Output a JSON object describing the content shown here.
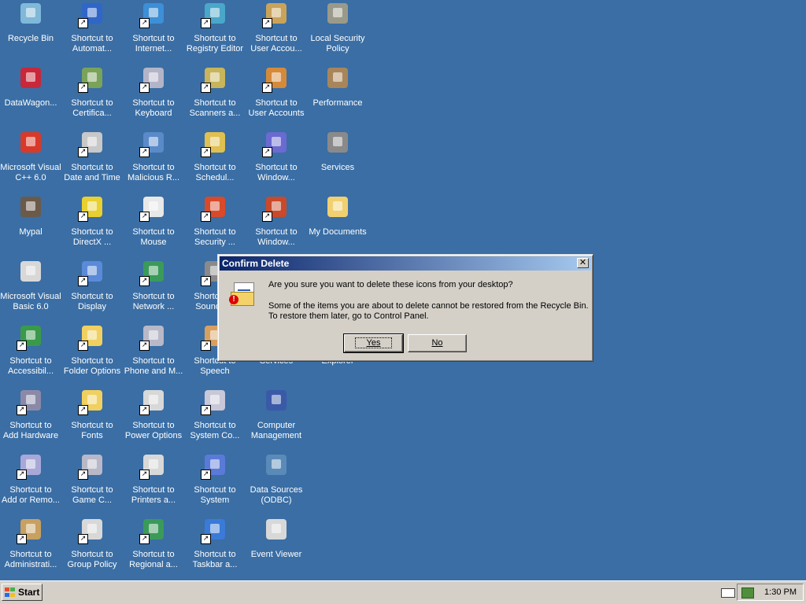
{
  "desktop": {
    "icons": [
      {
        "label": "Recycle Bin",
        "col": 0,
        "row": 0,
        "color": "#7fb8d8",
        "shortcut": false
      },
      {
        "label": "Shortcut to\nAutomat...",
        "col": 1,
        "row": 0,
        "color": "#2f66c8",
        "shortcut": true
      },
      {
        "label": "Shortcut to\nInternet...",
        "col": 2,
        "row": 0,
        "color": "#3d8fd6",
        "shortcut": true
      },
      {
        "label": "Shortcut to\nRegistry Editor",
        "col": 3,
        "row": 0,
        "color": "#4aa7c9",
        "shortcut": true
      },
      {
        "label": "Shortcut to\nUser Accou...",
        "col": 4,
        "row": 0,
        "color": "#c9a35a",
        "shortcut": true
      },
      {
        "label": "Local Security\nPolicy",
        "col": 5,
        "row": 0,
        "color": "#9a9a8a",
        "shortcut": false
      },
      {
        "label": "DataWagon...",
        "col": 0,
        "row": 1,
        "color": "#c8283a",
        "shortcut": false
      },
      {
        "label": "Shortcut to\nCertifica...",
        "col": 1,
        "row": 1,
        "color": "#7aa35a",
        "shortcut": true
      },
      {
        "label": "Shortcut to\nKeyboard",
        "col": 2,
        "row": 1,
        "color": "#b4b4c8",
        "shortcut": true
      },
      {
        "label": "Shortcut to\nScanners a...",
        "col": 3,
        "row": 1,
        "color": "#c8b45a",
        "shortcut": true
      },
      {
        "label": "Shortcut to\nUser Accounts",
        "col": 4,
        "row": 1,
        "color": "#d48a3a",
        "shortcut": true
      },
      {
        "label": "Performance",
        "col": 5,
        "row": 1,
        "color": "#a8865a",
        "shortcut": false
      },
      {
        "label": "Microsoft Visual\nC++ 6.0",
        "col": 0,
        "row": 2,
        "color": "#d83a2a",
        "shortcut": false
      },
      {
        "label": "Shortcut to\nDate and Time",
        "col": 1,
        "row": 2,
        "color": "#c8c8c8",
        "shortcut": true
      },
      {
        "label": "Shortcut to\nMalicious R...",
        "col": 2,
        "row": 2,
        "color": "#5a8ac8",
        "shortcut": true
      },
      {
        "label": "Shortcut to\nSchedul...",
        "col": 3,
        "row": 2,
        "color": "#e0c050",
        "shortcut": true
      },
      {
        "label": "Shortcut to\nWindow...",
        "col": 4,
        "row": 2,
        "color": "#6a6ad0",
        "shortcut": true
      },
      {
        "label": "Services",
        "col": 5,
        "row": 2,
        "color": "#8a8a8a",
        "shortcut": false
      },
      {
        "label": "Mypal",
        "col": 0,
        "row": 3,
        "color": "#6a5a4a",
        "shortcut": false
      },
      {
        "label": "Shortcut to\nDirectX ...",
        "col": 1,
        "row": 3,
        "color": "#e8d030",
        "shortcut": true
      },
      {
        "label": "Shortcut to\nMouse",
        "col": 2,
        "row": 3,
        "color": "#e8e8e8",
        "shortcut": true
      },
      {
        "label": "Shortcut to\nSecurity ...",
        "col": 3,
        "row": 3,
        "color": "#d84a2a",
        "shortcut": true
      },
      {
        "label": "Shortcut to\nWindow...",
        "col": 4,
        "row": 3,
        "color": "#c84a2a",
        "shortcut": true
      },
      {
        "label": "My Documents",
        "col": 5,
        "row": 3,
        "color": "#f0d070",
        "shortcut": false
      },
      {
        "label": "Microsoft Visual\nBasic 6.0",
        "col": 0,
        "row": 4,
        "color": "#d8d8d8",
        "shortcut": false
      },
      {
        "label": "Shortcut to\nDisplay",
        "col": 1,
        "row": 4,
        "color": "#5a8ad8",
        "shortcut": true
      },
      {
        "label": "Shortcut to\nNetwork ...",
        "col": 2,
        "row": 4,
        "color": "#3a9a5a",
        "shortcut": true
      },
      {
        "label": "Shortcut to\nSounds ...",
        "col": 3,
        "row": 4,
        "color": "#8a8a8a",
        "shortcut": true
      },
      {
        "label": "Shortcut to\nAccessibil...",
        "col": 0,
        "row": 5,
        "color": "#3a9a4a",
        "shortcut": true
      },
      {
        "label": "Shortcut to\nFolder Options",
        "col": 1,
        "row": 5,
        "color": "#f0d060",
        "shortcut": true
      },
      {
        "label": "Shortcut to\nPhone and M...",
        "col": 2,
        "row": 5,
        "color": "#b8b8c8",
        "shortcut": true
      },
      {
        "label": "Shortcut to\nSpeech",
        "col": 3,
        "row": 5,
        "color": "#d8a060",
        "shortcut": true
      },
      {
        "label": "Services",
        "col": 4,
        "row": 5,
        "color": "#3a6ea5",
        "shortcut": false,
        "hidden_icon": true
      },
      {
        "label": "Explorer",
        "col": 5,
        "row": 5,
        "color": "#3a6ea5",
        "shortcut": false,
        "hidden_icon": true
      },
      {
        "label": "Shortcut to\nAdd Hardware",
        "col": 0,
        "row": 6,
        "color": "#8a8aa8",
        "shortcut": true
      },
      {
        "label": "Shortcut to\nFonts",
        "col": 1,
        "row": 6,
        "color": "#f0d060",
        "shortcut": true
      },
      {
        "label": "Shortcut to\nPower Options",
        "col": 2,
        "row": 6,
        "color": "#d8d8d8",
        "shortcut": true
      },
      {
        "label": "Shortcut to\nSystem Co...",
        "col": 3,
        "row": 6,
        "color": "#c8c8d8",
        "shortcut": true
      },
      {
        "label": "Computer\nManagement",
        "col": 4,
        "row": 6,
        "color": "#3a5aa8",
        "shortcut": false
      },
      {
        "label": "Shortcut to\nAdd or Remo...",
        "col": 0,
        "row": 7,
        "color": "#a8a8d8",
        "shortcut": true
      },
      {
        "label": "Shortcut to\nGame C...",
        "col": 1,
        "row": 7,
        "color": "#b8b8c8",
        "shortcut": true
      },
      {
        "label": "Shortcut to\nPrinters a...",
        "col": 2,
        "row": 7,
        "color": "#d8d8d8",
        "shortcut": true
      },
      {
        "label": "Shortcut to\nSystem",
        "col": 3,
        "row": 7,
        "color": "#5a7ad8",
        "shortcut": true
      },
      {
        "label": "Data Sources\n(ODBC)",
        "col": 4,
        "row": 7,
        "color": "#5a8ab8",
        "shortcut": false
      },
      {
        "label": "Shortcut to\nAdministrati...",
        "col": 0,
        "row": 8,
        "color": "#c8a060",
        "shortcut": true
      },
      {
        "label": "Shortcut to\nGroup Policy",
        "col": 1,
        "row": 8,
        "color": "#d8d8d8",
        "shortcut": true
      },
      {
        "label": "Shortcut to\nRegional a...",
        "col": 2,
        "row": 8,
        "color": "#3a9a5a",
        "shortcut": true
      },
      {
        "label": "Shortcut to\nTaskbar a...",
        "col": 3,
        "row": 8,
        "color": "#3a7ad8",
        "shortcut": true
      },
      {
        "label": "Event Viewer",
        "col": 4,
        "row": 8,
        "color": "#d8d8d8",
        "shortcut": false
      }
    ]
  },
  "dialog": {
    "title": "Confirm Delete",
    "close_glyph": "✕",
    "question": "Are you sure you want to delete these icons from your desktop?",
    "detail_line1": "Some of the items you are about to delete cannot be restored from the Recycle Bin.",
    "detail_line2": "To restore them later, go to Control Panel.",
    "yes_label": "Yes",
    "no_label": "No",
    "icon": "recycle-warning-icon",
    "bang": "!"
  },
  "taskbar": {
    "start_label": "Start",
    "clock": "1:30 PM",
    "tray_icons": [
      "keyboard-icon",
      "network-icon"
    ]
  },
  "colors": {
    "desktop_bg": "#3a6ea5",
    "title_start": "#0a246a",
    "title_end": "#a6caf0",
    "face": "#d4d0c8"
  }
}
